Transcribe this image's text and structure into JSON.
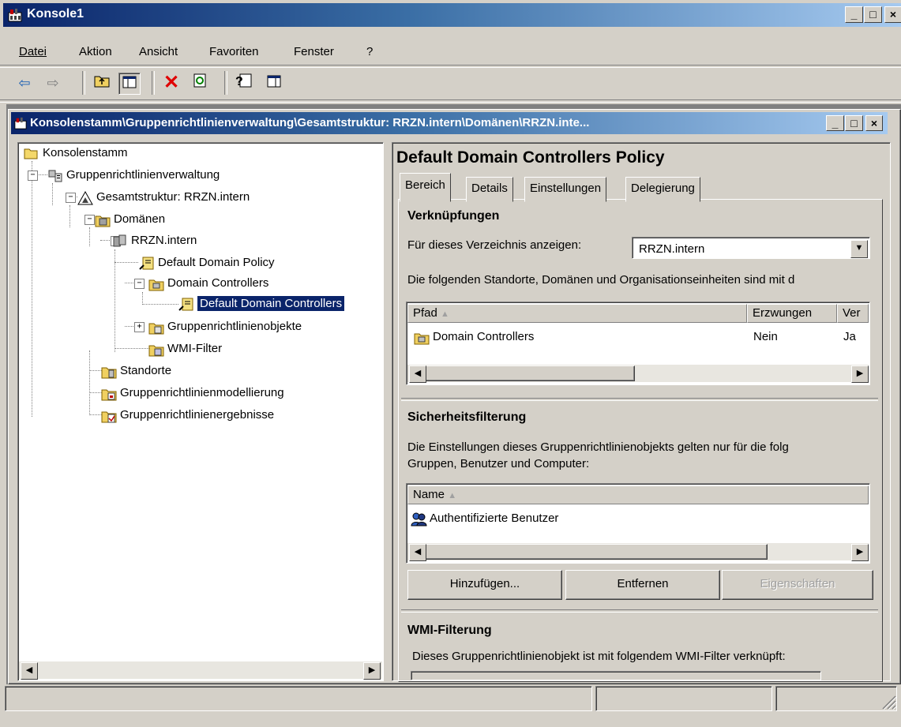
{
  "app": {
    "title": "Konsole1",
    "caption_buttons": [
      "_",
      "□",
      "×"
    ]
  },
  "menu": [
    {
      "label": "Datei"
    },
    {
      "label": "Aktion"
    },
    {
      "label": "Ansicht"
    },
    {
      "label": "Favoriten"
    },
    {
      "label": "Fenster"
    },
    {
      "label": "?"
    }
  ],
  "toolbar": {
    "icons": [
      "back-icon",
      "forward-icon",
      "up-folder-icon",
      "show-hide-tree-icon",
      "delete-icon",
      "refresh-icon",
      "help-icon",
      "show-hide-action-pane-icon"
    ]
  },
  "child_window": {
    "title": "Konsolenstamm\\Gruppenrichtlinienverwaltung\\Gesamtstruktur: RRZN.intern\\Domänen\\RRZN.inte..."
  },
  "tree": {
    "items": [
      {
        "label": "Konsolenstamm",
        "icon": "folder-icon"
      },
      {
        "label": "Gruppenrichtlinienverwaltung",
        "icon": "gpm-icon"
      },
      {
        "label": "Gesamtstruktur: RRZN.intern",
        "icon": "forest-icon"
      },
      {
        "label": "Domänen",
        "icon": "domains-icon"
      },
      {
        "label": "RRZN.intern",
        "icon": "domain-icon"
      },
      {
        "label": "Default Domain Policy",
        "icon": "gpo-link-icon"
      },
      {
        "label": "Domain Controllers",
        "icon": "ou-icon"
      },
      {
        "label": "Default Domain Controllers",
        "icon": "gpo-link-icon",
        "selected": true
      },
      {
        "label": "Gruppenrichtlinienobjekte",
        "icon": "gpo-folder-icon"
      },
      {
        "label": "WMI-Filter",
        "icon": "wmi-folder-icon"
      },
      {
        "label": "Standorte",
        "icon": "sites-icon"
      },
      {
        "label": "Gruppenrichtlinienmodellierung",
        "icon": "modeling-icon"
      },
      {
        "label": "Gruppenrichtlinienergebnisse",
        "icon": "results-icon"
      }
    ]
  },
  "detail": {
    "heading": "Default Domain Controllers Policy",
    "tabs": [
      "Bereich",
      "Details",
      "Einstellungen",
      "Delegierung"
    ],
    "links": {
      "heading": "Verknüpfungen",
      "show_for_label": "Für dieses Verzeichnis anzeigen:",
      "show_for_value": "RRZN.intern",
      "description": "Die folgenden Standorte, Domänen und Organisationseinheiten sind mit d",
      "columns": [
        "Pfad",
        "Erzwungen",
        "Ver"
      ],
      "rows": [
        {
          "path": "Domain Controllers",
          "enforced": "Nein",
          "enabled": "Ja"
        }
      ]
    },
    "security": {
      "heading": "Sicherheitsfilterung",
      "description_line1": "Die Einstellungen dieses Gruppenrichtlinienobjekts gelten nur für die folg",
      "description_line2": "Gruppen, Benutzer und Computer:",
      "columns": [
        "Name"
      ],
      "rows": [
        {
          "name": "Authentifizierte Benutzer"
        }
      ],
      "buttons": {
        "add": "Hinzufügen...",
        "remove": "Entfernen",
        "properties": "Eigenschaften"
      }
    },
    "wmi": {
      "heading": "WMI-Filterung",
      "description": "Dieses Gruppenrichtlinienobjekt ist mit folgendem WMI-Filter verknüpft:"
    }
  },
  "colors": {
    "title_start": "#0a246a",
    "title_end": "#a6caf0",
    "face": "#d4d0c8",
    "selection": "#0a246a"
  }
}
